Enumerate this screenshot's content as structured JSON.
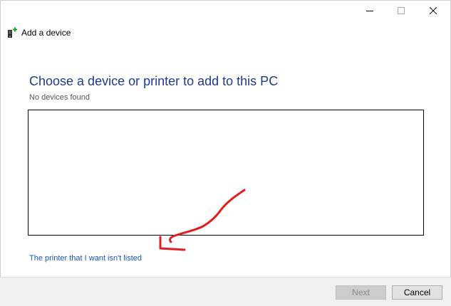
{
  "window": {
    "minimize_icon": "minimize-icon",
    "maximize_icon": "maximize-icon",
    "close_icon": "close-icon"
  },
  "header": {
    "icon": "add-device-icon",
    "title": "Add a device"
  },
  "main": {
    "heading": "Choose a device or printer to add to this PC",
    "status": "No devices found",
    "devices": [],
    "link": "The printer that I want isn't listed"
  },
  "footer": {
    "next_label": "Next",
    "next_enabled": false,
    "cancel_label": "Cancel"
  },
  "colors": {
    "heading": "#1e3c8c",
    "link": "#1a56b4",
    "annotation": "#e02020"
  }
}
